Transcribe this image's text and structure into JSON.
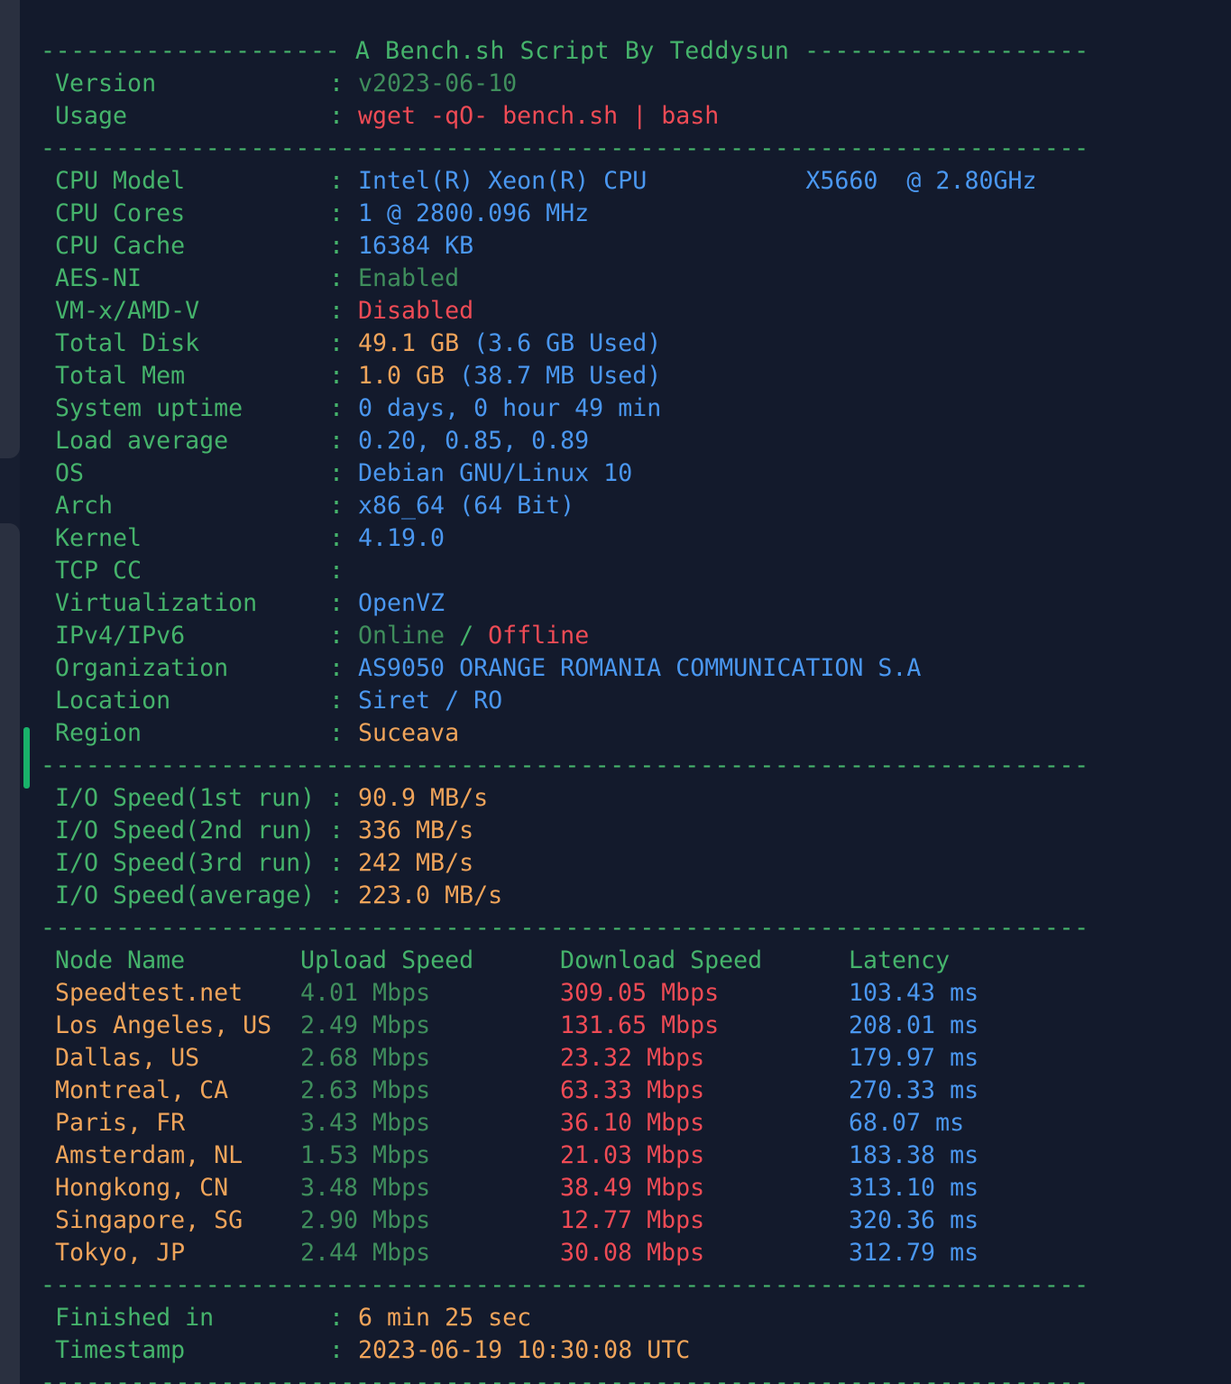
{
  "header": {
    "title_line": "-------------------- A Bench.sh Script By Teddysun -------------------",
    "separator": "----------------------------------------------------------------------"
  },
  "intro": [
    {
      "label": "Version",
      "value": "v2023-06-10",
      "color": "#3f8e5c"
    },
    {
      "label": "Usage",
      "value": "wget -qO- bench.sh | bash",
      "color": "#ef4b55"
    }
  ],
  "system": {
    "cpu_model": {
      "label": "CPU Model",
      "value": "Intel(R) Xeon(R) CPU           X5660  @ 2.80GHz"
    },
    "cpu_cores": {
      "label": "CPU Cores",
      "value": "1 @ 2800.096 MHz"
    },
    "cpu_cache": {
      "label": "CPU Cache",
      "value": "16384 KB"
    },
    "aes_ni": {
      "label": "AES-NI",
      "value": "Enabled"
    },
    "vmx": {
      "label": "VM-x/AMD-V",
      "value": "Disabled"
    },
    "total_disk": {
      "label": "Total Disk",
      "value": "49.1 GB",
      "used": "(3.6 GB Used)"
    },
    "total_mem": {
      "label": "Total Mem",
      "value": "1.0 GB",
      "used": "(38.7 MB Used)"
    },
    "uptime": {
      "label": "System uptime",
      "value": "0 days, 0 hour 49 min"
    },
    "load": {
      "label": "Load average",
      "value": "0.20, 0.85, 0.89"
    },
    "os": {
      "label": "OS",
      "value": "Debian GNU/Linux 10"
    },
    "arch": {
      "label": "Arch",
      "value": "x86_64 (64 Bit)"
    },
    "kernel": {
      "label": "Kernel",
      "value": "4.19.0"
    },
    "tcp_cc": {
      "label": "TCP CC",
      "value": ""
    },
    "virt": {
      "label": "Virtualization",
      "value": "OpenVZ"
    },
    "ip": {
      "label": "IPv4/IPv6",
      "v4": "Online",
      "slash": "/",
      "v6": "Offline"
    },
    "org": {
      "label": "Organization",
      "value": "AS9050 ORANGE ROMANIA COMMUNICATION S.A"
    },
    "location": {
      "label": "Location",
      "value": "Siret / RO"
    },
    "region": {
      "label": "Region",
      "value": "Suceava"
    }
  },
  "io": [
    {
      "label": "I/O Speed(1st run)",
      "value": "90.9 MB/s"
    },
    {
      "label": "I/O Speed(2nd run)",
      "value": "336 MB/s"
    },
    {
      "label": "I/O Speed(3rd run)",
      "value": "242 MB/s"
    },
    {
      "label": "I/O Speed(average)",
      "value": "223.0 MB/s"
    }
  ],
  "speedtest": {
    "headers": {
      "node": "Node Name",
      "upload": "Upload Speed",
      "download": "Download Speed",
      "latency": "Latency"
    },
    "rows": [
      {
        "node": "Speedtest.net",
        "upload": "4.01 Mbps",
        "download": "309.05 Mbps",
        "latency": "103.43 ms"
      },
      {
        "node": "Los Angeles, US",
        "upload": "2.49 Mbps",
        "download": "131.65 Mbps",
        "latency": "208.01 ms"
      },
      {
        "node": "Dallas, US",
        "upload": "2.68 Mbps",
        "download": "23.32 Mbps",
        "latency": "179.97 ms"
      },
      {
        "node": "Montreal, CA",
        "upload": "2.63 Mbps",
        "download": "63.33 Mbps",
        "latency": "270.33 ms"
      },
      {
        "node": "Paris, FR",
        "upload": "3.43 Mbps",
        "download": "36.10 Mbps",
        "latency": "68.07 ms"
      },
      {
        "node": "Amsterdam, NL",
        "upload": "1.53 Mbps",
        "download": "21.03 Mbps",
        "latency": "183.38 ms"
      },
      {
        "node": "Hongkong, CN",
        "upload": "3.48 Mbps",
        "download": "38.49 Mbps",
        "latency": "313.10 ms"
      },
      {
        "node": "Singapore, SG",
        "upload": "2.90 Mbps",
        "download": "12.77 Mbps",
        "latency": "320.36 ms"
      },
      {
        "node": "Tokyo, JP",
        "upload": "2.44 Mbps",
        "download": "30.08 Mbps",
        "latency": "312.79 ms"
      }
    ]
  },
  "footer": [
    {
      "label": "Finished in",
      "value": "6 min 25 sec"
    },
    {
      "label": "Timestamp",
      "value": "2023-06-19 10:30:08 UTC"
    }
  ],
  "colors": {
    "background": "#131a2c",
    "green": "#45b36b",
    "red": "#ef4b55",
    "blue": "#4a97f0",
    "yellow": "#f0a45a"
  }
}
